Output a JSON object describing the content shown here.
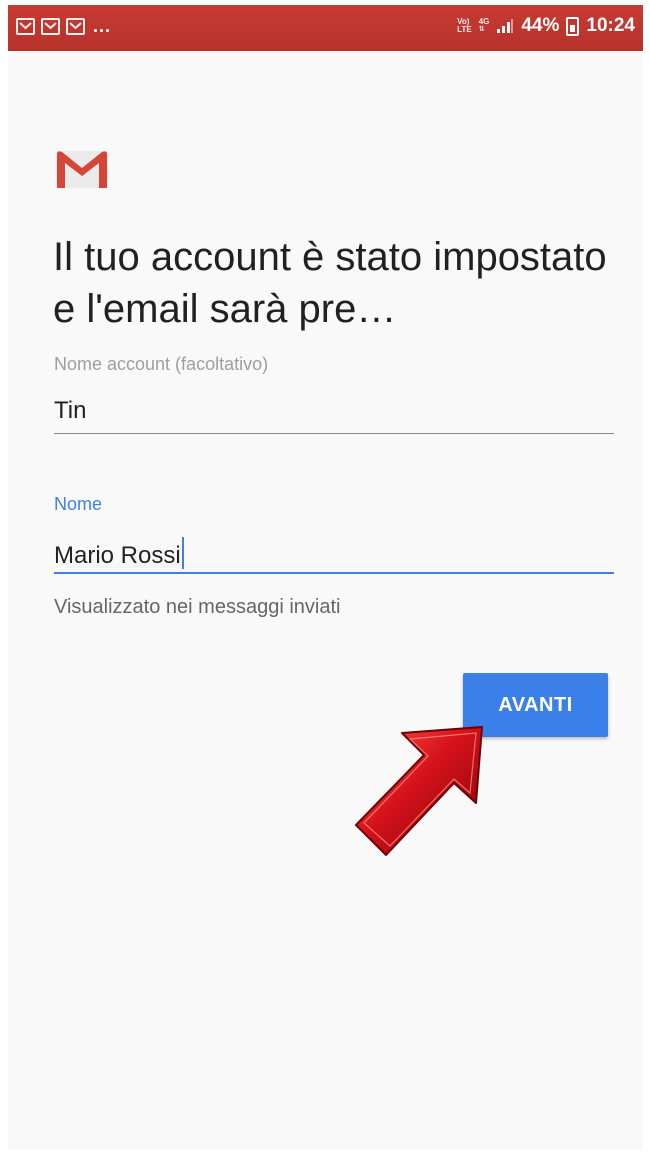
{
  "status_bar": {
    "notifications": [
      "email-icon",
      "email-icon",
      "email-icon"
    ],
    "ellipsis": "...",
    "volte": "Vo)",
    "lte": "LTE",
    "network": "4G",
    "battery_percent": "44%",
    "time": "10:24",
    "background": "#b93a30"
  },
  "app": {
    "logo": "gmail-logo"
  },
  "setup": {
    "title": "Il tuo account è stato impostato e l'email sarà pre…",
    "account_name": {
      "label": "Nome account (facoltativo)",
      "value": "Tin"
    },
    "name": {
      "label": "Nome",
      "value": "Mario Rossi",
      "helper": "Visualizzato nei messaggi inviati"
    },
    "next_button": "AVANTI"
  },
  "colors": {
    "accent": "#3f7fe6",
    "button": "#3a80e8",
    "arrow": "#c4141c"
  }
}
